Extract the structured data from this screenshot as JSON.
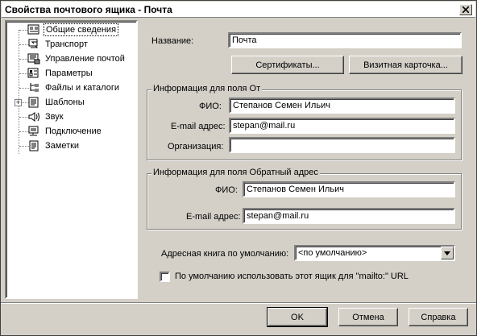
{
  "window": {
    "title": "Свойства почтового ящика - Почта"
  },
  "tree": {
    "items": [
      {
        "label": "Общие сведения",
        "icon": "general-info-icon"
      },
      {
        "label": "Транспорт",
        "icon": "transport-icon"
      },
      {
        "label": "Управление почтой",
        "icon": "mail-management-icon"
      },
      {
        "label": "Параметры",
        "icon": "parameters-icon"
      },
      {
        "label": "Файлы и каталоги",
        "icon": "files-folders-icon"
      },
      {
        "label": "Шаблоны",
        "icon": "templates-icon"
      },
      {
        "label": "Звук",
        "icon": "sound-icon"
      },
      {
        "label": "Подключение",
        "icon": "connection-icon"
      },
      {
        "label": "Заметки",
        "icon": "notes-icon"
      }
    ],
    "expander": "+"
  },
  "general": {
    "name_label": "Название:",
    "name_value": "Почта",
    "certificates_button": "Сертификаты...",
    "business_card_button": "Визитная карточка..."
  },
  "from_group": {
    "title": "Информация для поля От",
    "fio_label": "ФИО:",
    "fio_value": "Степанов Семен Ильич",
    "email_label": "E-mail адрес:",
    "email_value": "stepan@mail.ru",
    "org_label": "Организация:",
    "org_value": ""
  },
  "reply_group": {
    "title": "Информация для поля Обратный адрес",
    "fio_label": "ФИО:",
    "fio_value": "Степанов Семен Ильич",
    "email_label": "E-mail адрес:",
    "email_value": "stepan@mail.ru"
  },
  "address_book": {
    "label": "Адресная книга по умолчанию:",
    "value": "<по умолчанию>"
  },
  "mailto_checkbox": {
    "label": "По умолчанию использовать этот ящик для \"mailto:\" URL",
    "checked": false
  },
  "footer": {
    "ok": "OK",
    "cancel": "Отмена",
    "help": "Справка"
  }
}
